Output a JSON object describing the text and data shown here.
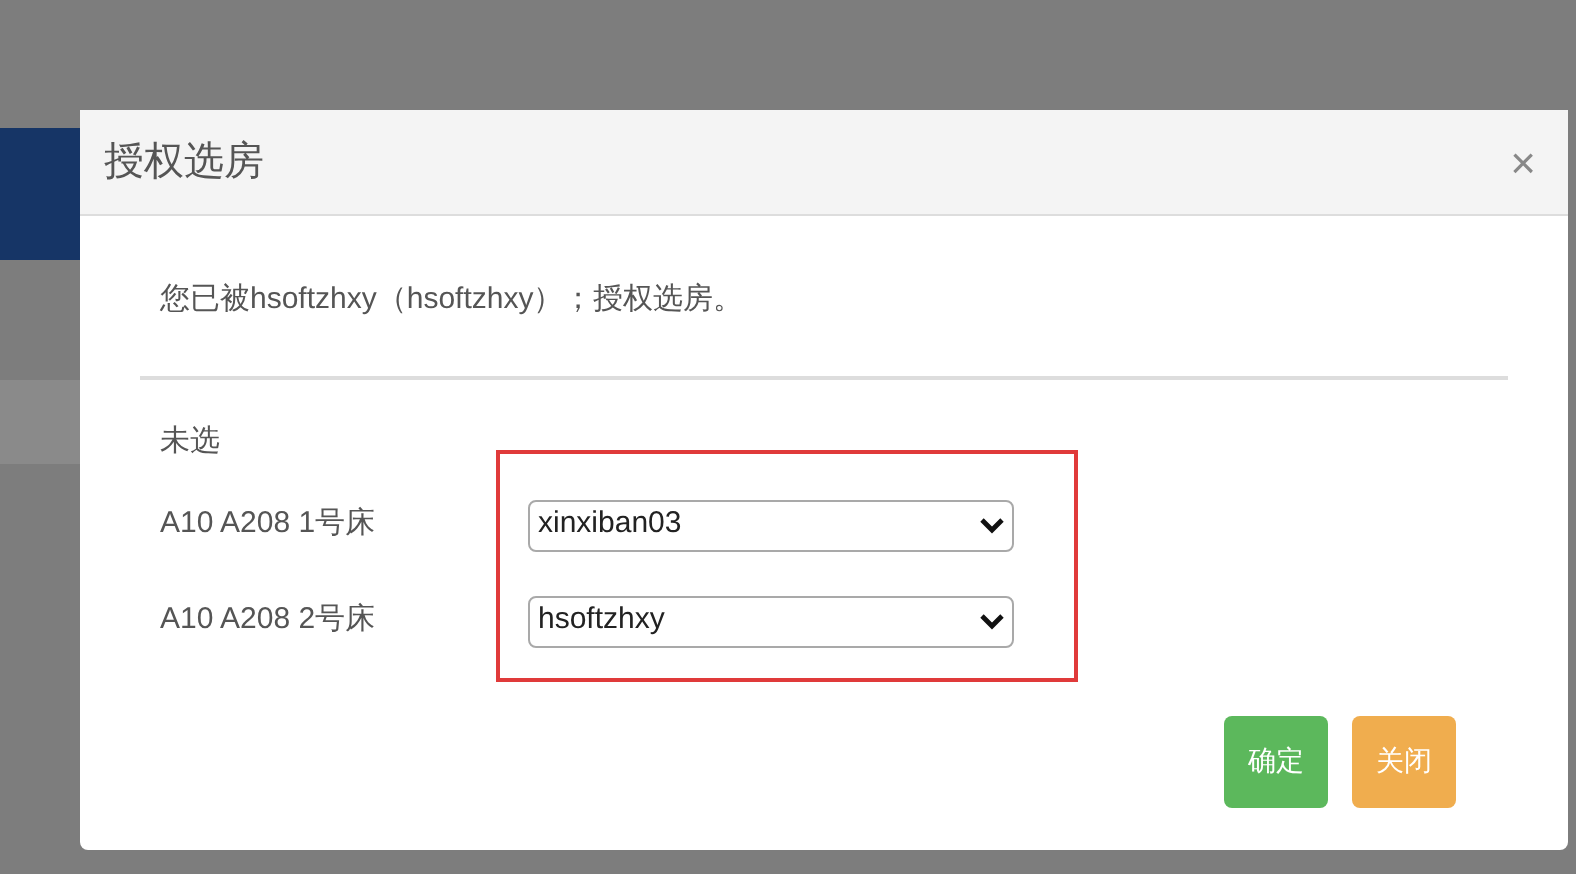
{
  "dialog": {
    "title": "授权选房",
    "close": "×",
    "message": "您已被hsoftzhxy（hsoftzhxy）；授权选房。",
    "section_label": "未选",
    "beds": [
      {
        "label": "A10 A208 1号床",
        "value": "xinxiban03"
      },
      {
        "label": "A10 A208 2号床",
        "value": "hsoftzhxy"
      }
    ],
    "buttons": [
      {
        "label": "确定",
        "kind": "confirm"
      },
      {
        "label": "关闭",
        "kind": "close"
      }
    ]
  }
}
